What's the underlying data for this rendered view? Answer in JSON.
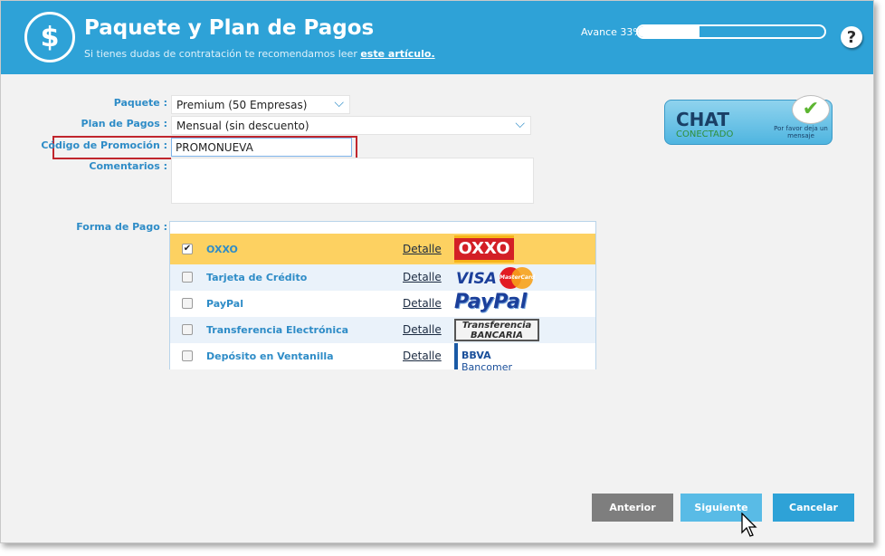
{
  "header": {
    "title": "Paquete y Plan de Pagos",
    "subtitle": "Si tienes dudas de contratación te recomendamos leer",
    "subtitle_link": "este artículo.",
    "progress_label": "Avance 33%",
    "progress_fraction": 0.33,
    "help_symbol": "?",
    "icon": "dollar-icon"
  },
  "form": {
    "package_label": "Paquete :",
    "package_value": "Premium (50 Empresas)",
    "plan_label": "Plan de Pagos :",
    "plan_value": "Mensual (sin descuento)",
    "promo_label": "Código de Promoción :",
    "promo_value": "PROMONUEVA",
    "comments_label": "Comentarios :",
    "comments_value": "",
    "payment_label": "Forma de Pago :"
  },
  "chat": {
    "title": "CHAT",
    "status": "CONECTADO",
    "message": "Por favor deja un mensaje"
  },
  "payments": [
    {
      "name": "OXXO",
      "detail": "Detalle",
      "checked": true,
      "logo": "OXXO"
    },
    {
      "name": "Tarjeta de Crédito",
      "detail": "Detalle",
      "checked": false,
      "logo_visa": "VISA",
      "logo_mc": "MasterCard"
    },
    {
      "name": "PayPal",
      "detail": "Detalle",
      "checked": false,
      "logo": "PayPal"
    },
    {
      "name": "Transferencia Electrónica",
      "detail": "Detalle",
      "checked": false,
      "logo_line1": "Transferencia",
      "logo_line2": "BANCARIA"
    },
    {
      "name": "Depósito en Ventanilla",
      "detail": "Detalle",
      "checked": false,
      "logo_bbva": "BBVA",
      "logo_bancomer": "Bancomer"
    }
  ],
  "buttons": {
    "previous": "Anterior",
    "next": "Siguiente",
    "cancel": "Cancelar"
  },
  "colors": {
    "header": "#2ea2d7",
    "label": "#2e8cc7",
    "selected_row": "#fdd161",
    "promo_highlight": "#c0262d"
  }
}
